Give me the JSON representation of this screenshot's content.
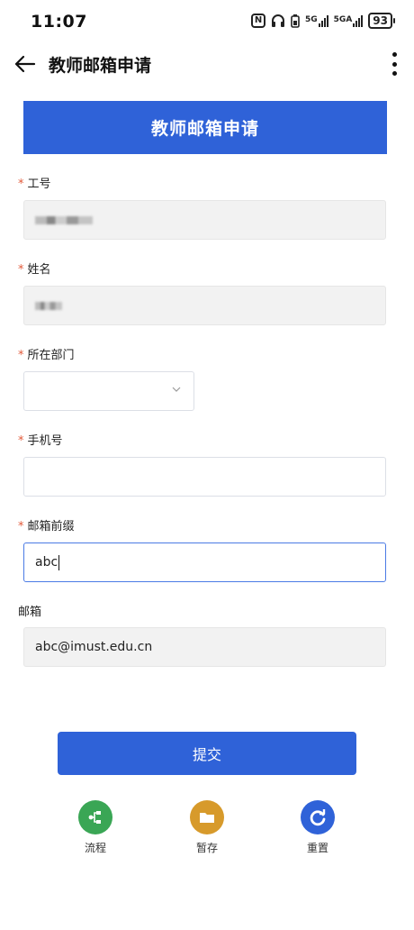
{
  "status_bar": {
    "time": "11:07",
    "battery": "93",
    "signal1_label": "5G",
    "signal2_label": "5GA"
  },
  "nav": {
    "title": "教师邮箱申请"
  },
  "banner": {
    "title": "教师邮箱申请"
  },
  "form": {
    "required_mark": "*",
    "fields": [
      {
        "label": "工号",
        "required": true,
        "value": "",
        "state": "disabled"
      },
      {
        "label": "姓名",
        "required": true,
        "value": "",
        "state": "disabled"
      },
      {
        "label": "所在部门",
        "required": true,
        "value": "",
        "state": "select"
      },
      {
        "label": "手机号",
        "required": true,
        "value": "",
        "state": "editable"
      },
      {
        "label": "邮箱前缀",
        "required": true,
        "value": "abc",
        "state": "focused"
      },
      {
        "label": "邮箱",
        "required": false,
        "value": "abc@imust.edu.cn",
        "state": "disabled"
      }
    ]
  },
  "submit": {
    "label": "提交"
  },
  "actions": [
    {
      "label": "流程",
      "icon": "flow-icon",
      "color": "#3aa655"
    },
    {
      "label": "暂存",
      "icon": "folder-icon",
      "color": "#d79a2b"
    },
    {
      "label": "重置",
      "icon": "refresh-icon",
      "color": "#2f62d8"
    }
  ],
  "colors": {
    "primary": "#2f62d8",
    "required": "#e25a3a"
  }
}
